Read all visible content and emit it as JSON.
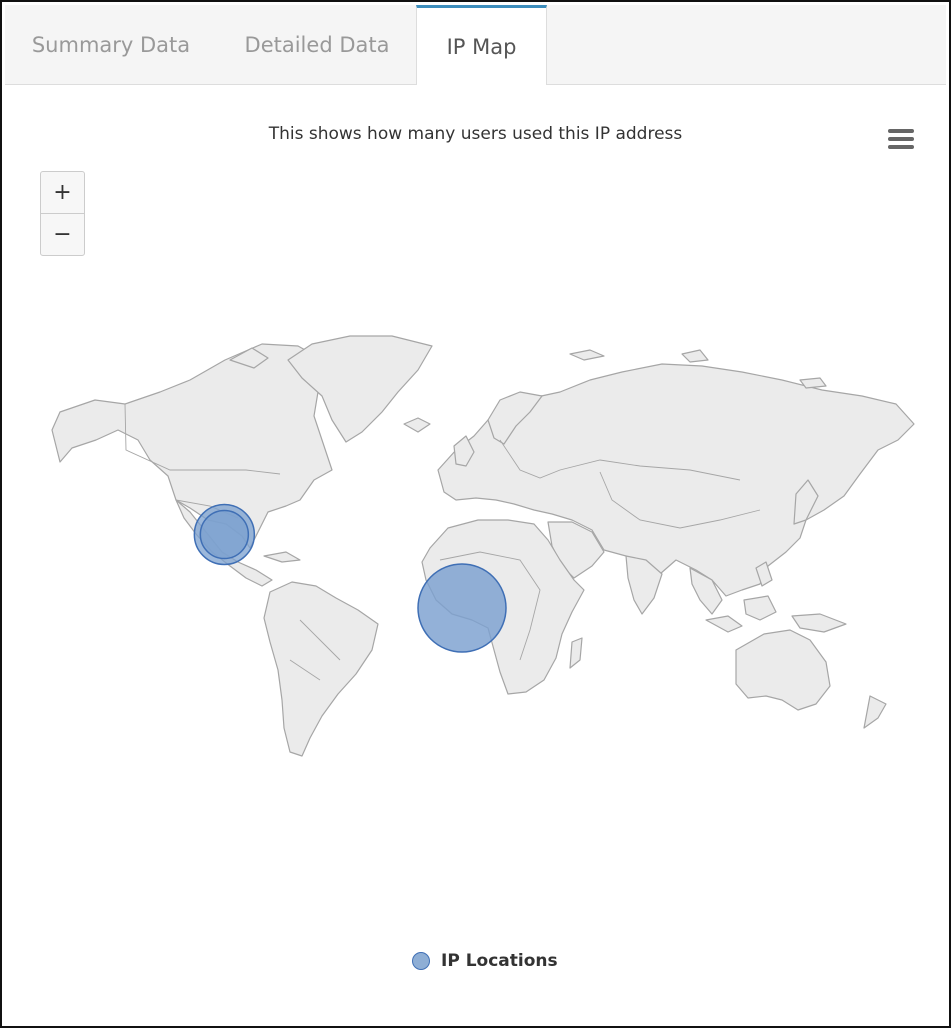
{
  "tabs": [
    {
      "label": "Summary Data",
      "active": false
    },
    {
      "label": "Detailed Data",
      "active": false
    },
    {
      "label": "IP Map",
      "active": true
    }
  ],
  "map": {
    "title": "This shows how many users used this IP address",
    "menu_icon": "hamburger-menu-icon",
    "zoom_in_label": "+",
    "zoom_out_label": "−",
    "legend_label": "IP Locations",
    "colors": {
      "land": "#ebebeb",
      "border": "#a6a6a6",
      "bubble_fill": "#7ba0cf",
      "bubble_stroke": "#3f6fb5"
    }
  },
  "chart_data": {
    "type": "bubble-map",
    "title": "This shows how many users used this IP address",
    "series": [
      {
        "name": "IP Locations",
        "points": [
          {
            "lat": 30,
            "lon": -97,
            "z": 2,
            "overlapping": true
          },
          {
            "lat": 0,
            "lon": 0,
            "z": 4
          }
        ]
      }
    ],
    "legend": "bottom-center"
  }
}
